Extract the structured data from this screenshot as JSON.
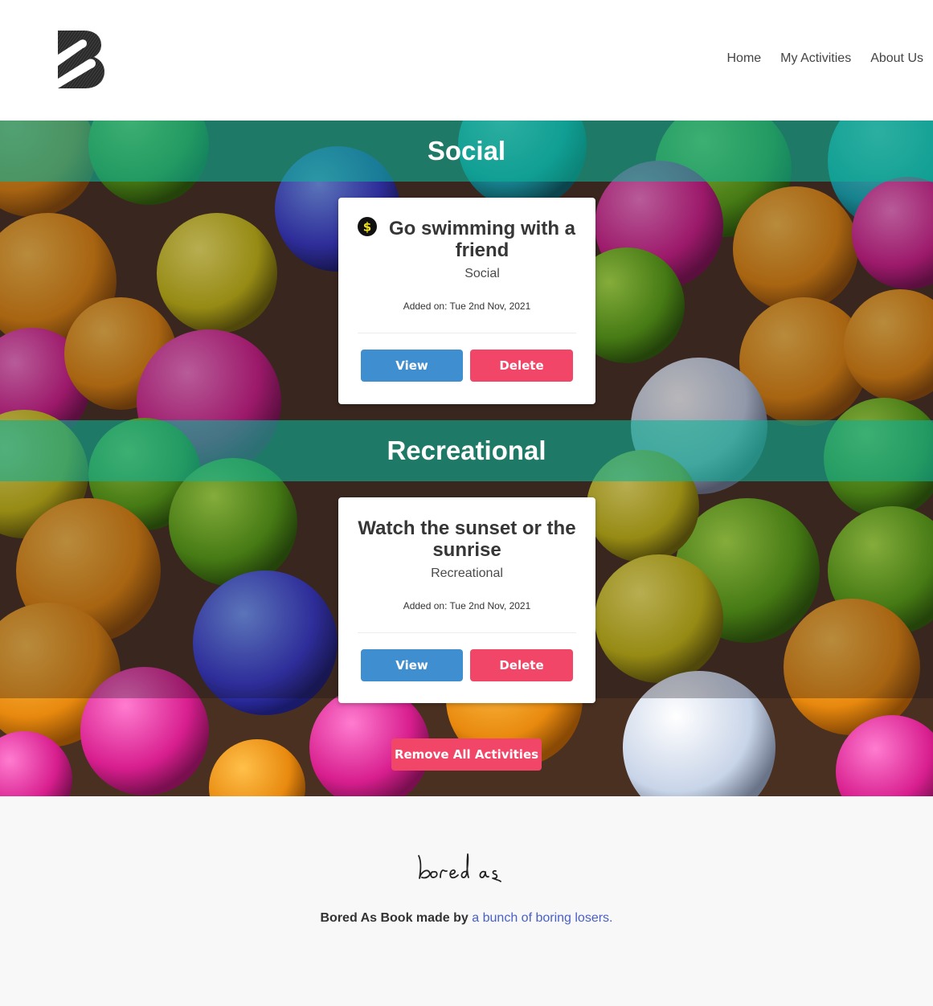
{
  "nav": {
    "home": "Home",
    "activities": "My Activities",
    "about": "About Us"
  },
  "sections": [
    {
      "heading": "Social",
      "card": {
        "title": "Go swimming with a friend",
        "type": "Social",
        "added": "Added on: Tue 2nd Nov, 2021",
        "has_cost_icon": true,
        "view_label": "View",
        "delete_label": "Delete"
      }
    },
    {
      "heading": "Recreational",
      "card": {
        "title": "Watch the sunset or the sunrise",
        "type": "Recreational",
        "added": "Added on: Tue 2nd Nov, 2021",
        "has_cost_icon": false,
        "view_label": "View",
        "delete_label": "Delete"
      }
    }
  ],
  "remove_all_label": "Remove All Activities",
  "footer": {
    "brand_script": "bored as",
    "credit_bold": "Bored As Book made by",
    "credit_link": "a bunch of boring losers."
  },
  "colors": {
    "band": "#0e9682",
    "view_button": "#3e8ed0",
    "delete_button": "#f14668",
    "link": "#485fc7"
  },
  "icons": {
    "cost": "dollar-coin-icon",
    "logo": "bored-as-b-logo"
  }
}
